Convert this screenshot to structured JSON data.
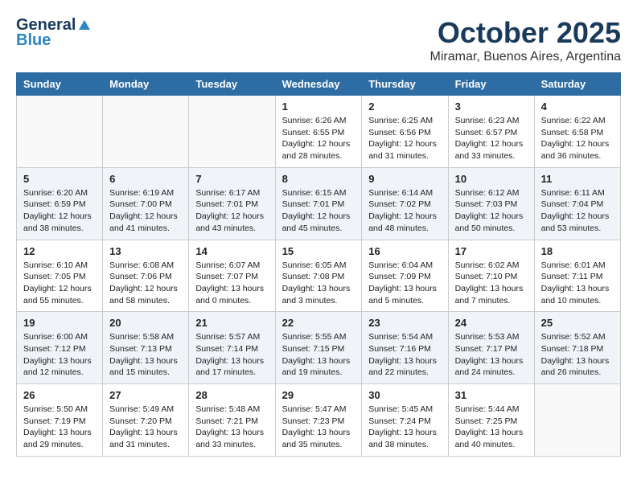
{
  "header": {
    "logo_line1": "General",
    "logo_line2": "Blue",
    "month": "October 2025",
    "location": "Miramar, Buenos Aires, Argentina"
  },
  "weekdays": [
    "Sunday",
    "Monday",
    "Tuesday",
    "Wednesday",
    "Thursday",
    "Friday",
    "Saturday"
  ],
  "weeks": [
    [
      {
        "day": "",
        "info": ""
      },
      {
        "day": "",
        "info": ""
      },
      {
        "day": "",
        "info": ""
      },
      {
        "day": "1",
        "info": "Sunrise: 6:26 AM\nSunset: 6:55 PM\nDaylight: 12 hours\nand 28 minutes."
      },
      {
        "day": "2",
        "info": "Sunrise: 6:25 AM\nSunset: 6:56 PM\nDaylight: 12 hours\nand 31 minutes."
      },
      {
        "day": "3",
        "info": "Sunrise: 6:23 AM\nSunset: 6:57 PM\nDaylight: 12 hours\nand 33 minutes."
      },
      {
        "day": "4",
        "info": "Sunrise: 6:22 AM\nSunset: 6:58 PM\nDaylight: 12 hours\nand 36 minutes."
      }
    ],
    [
      {
        "day": "5",
        "info": "Sunrise: 6:20 AM\nSunset: 6:59 PM\nDaylight: 12 hours\nand 38 minutes."
      },
      {
        "day": "6",
        "info": "Sunrise: 6:19 AM\nSunset: 7:00 PM\nDaylight: 12 hours\nand 41 minutes."
      },
      {
        "day": "7",
        "info": "Sunrise: 6:17 AM\nSunset: 7:01 PM\nDaylight: 12 hours\nand 43 minutes."
      },
      {
        "day": "8",
        "info": "Sunrise: 6:15 AM\nSunset: 7:01 PM\nDaylight: 12 hours\nand 45 minutes."
      },
      {
        "day": "9",
        "info": "Sunrise: 6:14 AM\nSunset: 7:02 PM\nDaylight: 12 hours\nand 48 minutes."
      },
      {
        "day": "10",
        "info": "Sunrise: 6:12 AM\nSunset: 7:03 PM\nDaylight: 12 hours\nand 50 minutes."
      },
      {
        "day": "11",
        "info": "Sunrise: 6:11 AM\nSunset: 7:04 PM\nDaylight: 12 hours\nand 53 minutes."
      }
    ],
    [
      {
        "day": "12",
        "info": "Sunrise: 6:10 AM\nSunset: 7:05 PM\nDaylight: 12 hours\nand 55 minutes."
      },
      {
        "day": "13",
        "info": "Sunrise: 6:08 AM\nSunset: 7:06 PM\nDaylight: 12 hours\nand 58 minutes."
      },
      {
        "day": "14",
        "info": "Sunrise: 6:07 AM\nSunset: 7:07 PM\nDaylight: 13 hours\nand 0 minutes."
      },
      {
        "day": "15",
        "info": "Sunrise: 6:05 AM\nSunset: 7:08 PM\nDaylight: 13 hours\nand 3 minutes."
      },
      {
        "day": "16",
        "info": "Sunrise: 6:04 AM\nSunset: 7:09 PM\nDaylight: 13 hours\nand 5 minutes."
      },
      {
        "day": "17",
        "info": "Sunrise: 6:02 AM\nSunset: 7:10 PM\nDaylight: 13 hours\nand 7 minutes."
      },
      {
        "day": "18",
        "info": "Sunrise: 6:01 AM\nSunset: 7:11 PM\nDaylight: 13 hours\nand 10 minutes."
      }
    ],
    [
      {
        "day": "19",
        "info": "Sunrise: 6:00 AM\nSunset: 7:12 PM\nDaylight: 13 hours\nand 12 minutes."
      },
      {
        "day": "20",
        "info": "Sunrise: 5:58 AM\nSunset: 7:13 PM\nDaylight: 13 hours\nand 15 minutes."
      },
      {
        "day": "21",
        "info": "Sunrise: 5:57 AM\nSunset: 7:14 PM\nDaylight: 13 hours\nand 17 minutes."
      },
      {
        "day": "22",
        "info": "Sunrise: 5:55 AM\nSunset: 7:15 PM\nDaylight: 13 hours\nand 19 minutes."
      },
      {
        "day": "23",
        "info": "Sunrise: 5:54 AM\nSunset: 7:16 PM\nDaylight: 13 hours\nand 22 minutes."
      },
      {
        "day": "24",
        "info": "Sunrise: 5:53 AM\nSunset: 7:17 PM\nDaylight: 13 hours\nand 24 minutes."
      },
      {
        "day": "25",
        "info": "Sunrise: 5:52 AM\nSunset: 7:18 PM\nDaylight: 13 hours\nand 26 minutes."
      }
    ],
    [
      {
        "day": "26",
        "info": "Sunrise: 5:50 AM\nSunset: 7:19 PM\nDaylight: 13 hours\nand 29 minutes."
      },
      {
        "day": "27",
        "info": "Sunrise: 5:49 AM\nSunset: 7:20 PM\nDaylight: 13 hours\nand 31 minutes."
      },
      {
        "day": "28",
        "info": "Sunrise: 5:48 AM\nSunset: 7:21 PM\nDaylight: 13 hours\nand 33 minutes."
      },
      {
        "day": "29",
        "info": "Sunrise: 5:47 AM\nSunset: 7:23 PM\nDaylight: 13 hours\nand 35 minutes."
      },
      {
        "day": "30",
        "info": "Sunrise: 5:45 AM\nSunset: 7:24 PM\nDaylight: 13 hours\nand 38 minutes."
      },
      {
        "day": "31",
        "info": "Sunrise: 5:44 AM\nSunset: 7:25 PM\nDaylight: 13 hours\nand 40 minutes."
      },
      {
        "day": "",
        "info": ""
      }
    ]
  ]
}
